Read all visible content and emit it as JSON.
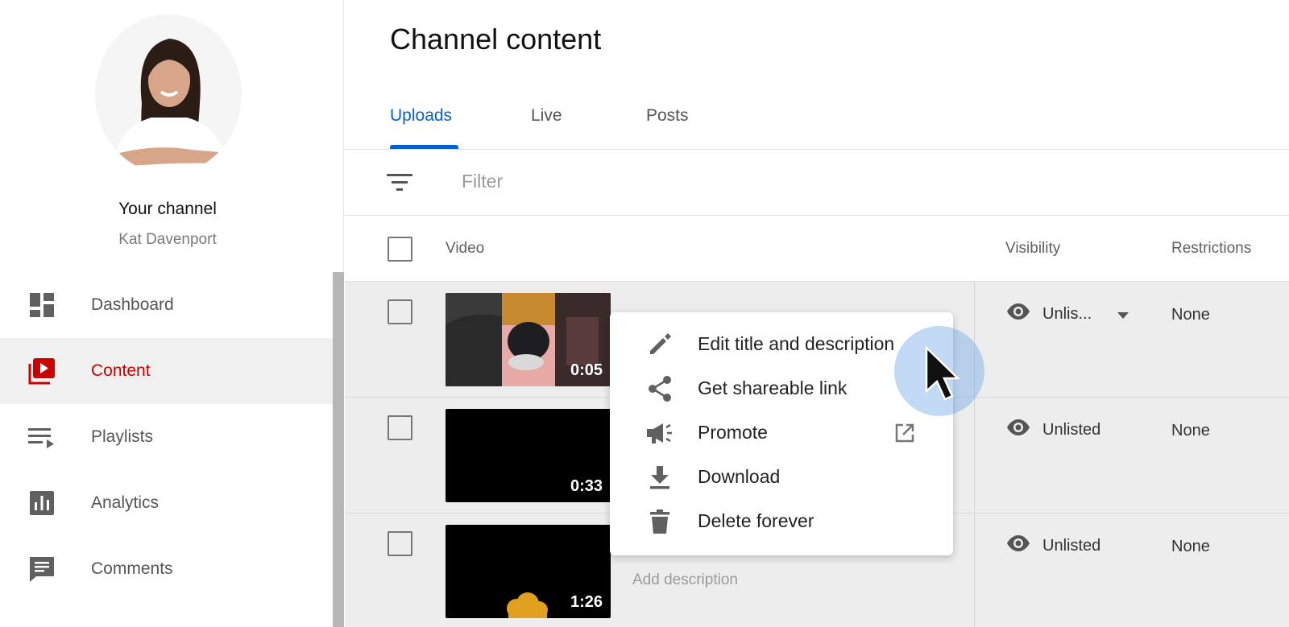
{
  "sidebar": {
    "channel_title": "Your channel",
    "channel_name": "Kat Davenport",
    "items": [
      {
        "label": "Dashboard",
        "icon": "dashboard-icon",
        "active": false
      },
      {
        "label": "Content",
        "icon": "content-icon",
        "active": true
      },
      {
        "label": "Playlists",
        "icon": "playlists-icon",
        "active": false
      },
      {
        "label": "Analytics",
        "icon": "analytics-icon",
        "active": false
      },
      {
        "label": "Comments",
        "icon": "comments-icon",
        "active": false
      }
    ]
  },
  "main": {
    "title": "Channel content",
    "tabs": [
      {
        "label": "Uploads",
        "active": true
      },
      {
        "label": "Live",
        "active": false
      },
      {
        "label": "Posts",
        "active": false
      }
    ],
    "filter": {
      "placeholder": "Filter"
    },
    "table": {
      "headers": {
        "video": "Video",
        "visibility": "Visibility",
        "restrictions": "Restrictions"
      },
      "rows": [
        {
          "duration": "0:05",
          "visibility": "Unlis...",
          "restrictions": "None"
        },
        {
          "duration": "0:33",
          "visibility": "Unlisted",
          "restrictions": "None"
        },
        {
          "duration": "1:26",
          "visibility": "Unlisted",
          "restrictions": "None",
          "description_placeholder": "Add description"
        }
      ]
    }
  },
  "context_menu": {
    "items": [
      {
        "label": "Edit title and description",
        "icon": "pencil-icon"
      },
      {
        "label": "Get shareable link",
        "icon": "share-icon"
      },
      {
        "label": "Promote",
        "icon": "megaphone-icon"
      },
      {
        "label": "Download",
        "icon": "download-icon"
      },
      {
        "label": "Delete forever",
        "icon": "trash-icon"
      }
    ]
  },
  "colors": {
    "accent_blue": "#065fd4",
    "active_red": "#cc0000",
    "row_background": "#ededed"
  }
}
